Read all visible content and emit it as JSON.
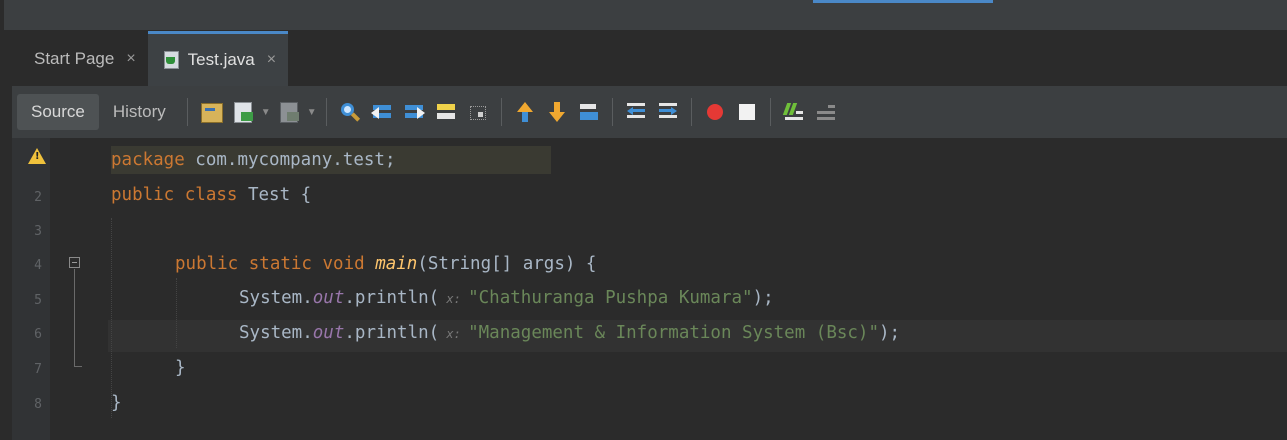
{
  "tabs": [
    {
      "label": "Start Page",
      "active": false
    },
    {
      "label": "Test.java",
      "active": true
    }
  ],
  "close_glyph": "×",
  "toolbar": {
    "source_label": "Source",
    "history_label": "History",
    "record_color": "#e53935"
  },
  "gutter": {
    "line_numbers": [
      "2",
      "3",
      "4",
      "5",
      "6",
      "7",
      "8"
    ],
    "warning_glyph": "!"
  },
  "code": {
    "l1_kw": "package",
    "l1_rest": " com.mycompany.test;",
    "l2_kw": "public class",
    "l2_rest": " Test {",
    "l4_kw": "public static void",
    "l4_fn": "main",
    "l4_rest": "(String[] args) {",
    "sys": "System.",
    "out": "out",
    "println": ".println(",
    "hint": " x: ",
    "str1": "\"Chathuranga Pushpa Kumara\"",
    "str2": "\"Management & Information System (Bsc)\"",
    "end": ");",
    "close_brace": "}"
  }
}
